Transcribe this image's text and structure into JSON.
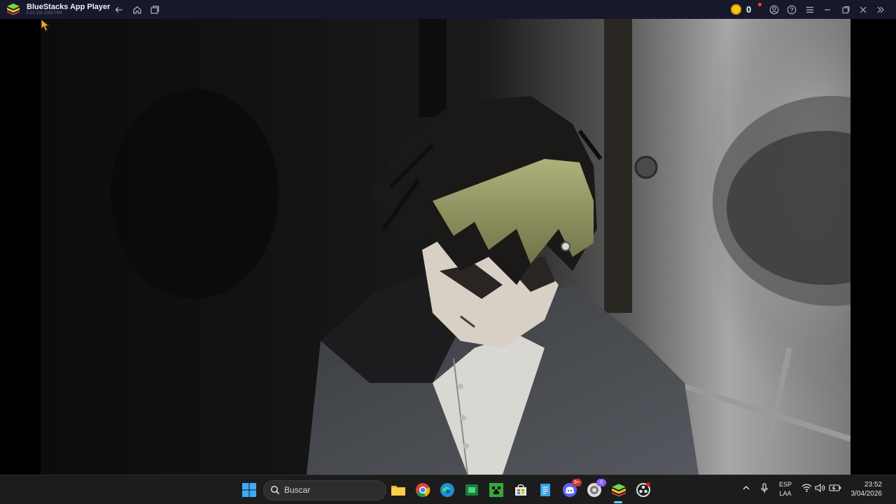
{
  "titlebar": {
    "app_title": "BlueStacks App Player",
    "version": "5.22.102.1002 P64",
    "coins": "0",
    "icons": [
      "back-icon",
      "home-icon",
      "multi-instance-icon",
      "coin-icon",
      "account-icon",
      "help-icon",
      "menu-icon",
      "minimize-icon",
      "maximize-icon",
      "close-icon",
      "sidebar-toggle-icon"
    ]
  },
  "scene": {
    "content": "anime video frame"
  },
  "taskbar": {
    "search_placeholder": "Buscar",
    "apps": [
      "windows-start-icon",
      "file-explorer-icon",
      "chrome-icon",
      "edge-icon",
      "spotify-app-icon",
      "minecraft-icon",
      "store-icon",
      "notepad-icon",
      "discord-icon",
      "steam-icon",
      "bluestacks-icon",
      "obs-icon"
    ],
    "discord_badge": "9+",
    "steam_badge": "0",
    "lang_top": "ESP",
    "lang_bottom": "LAA",
    "time": "23:52",
    "date": "3/04/2026"
  },
  "colors": {
    "titlebar_bg": "#17192b",
    "taskbar_bg": "#1c1c1c",
    "accent": "#60cdff",
    "coin": "#f5c518"
  }
}
